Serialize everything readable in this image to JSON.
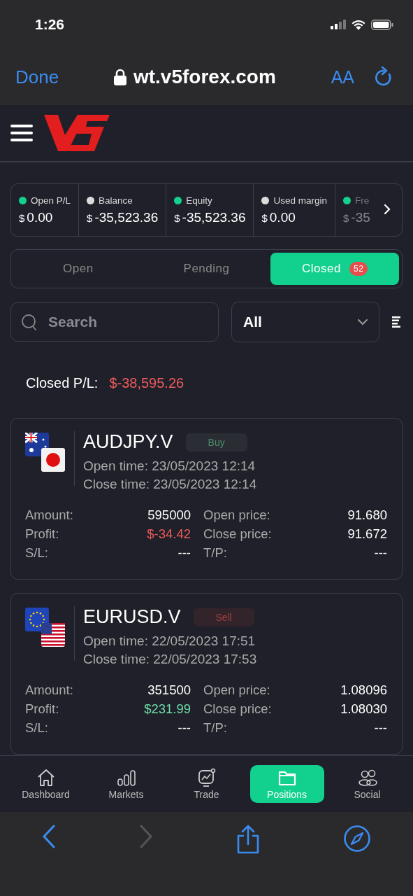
{
  "status_bar": {
    "time": "1:26"
  },
  "browser": {
    "done": "Done",
    "url": "wt.v5forex.com",
    "text_size": "AA",
    "forward_disabled": true
  },
  "summary": [
    {
      "label": "Open P/L",
      "currency": "$",
      "value": "0.00",
      "color": "#12d18e"
    },
    {
      "label": "Balance",
      "currency": "$",
      "value": "-35,523.36",
      "color": "#dcdcdc"
    },
    {
      "label": "Equity",
      "currency": "$",
      "value": "-35,523.36",
      "color": "#12d18e"
    },
    {
      "label": "Used margin",
      "currency": "$",
      "value": "0.00",
      "color": "#dcdcdc"
    },
    {
      "label": "Fre",
      "currency": "$",
      "value": "-35",
      "color": "#12d18e"
    }
  ],
  "tabs": [
    {
      "label": "Open",
      "selected": false
    },
    {
      "label": "Pending",
      "selected": false
    },
    {
      "label": "Closed",
      "selected": true,
      "badge": "52"
    }
  ],
  "search": {
    "placeholder": "Search"
  },
  "filter": {
    "value": "All"
  },
  "closed_pl": {
    "label": "Closed P/L:",
    "value": "$-38,595.26"
  },
  "positions": [
    {
      "symbol": "AUDJPY.V",
      "side": "Buy",
      "kind": "buy",
      "flags": [
        {
          "kind": "australia"
        },
        {
          "kind": "japan"
        }
      ],
      "open_time": "Open time: 23/05/2023 12:14",
      "close_time": "Close time: 23/05/2023 12:14",
      "stats": [
        {
          "label": "Amount:",
          "value": "595000",
          "kind": "plain"
        },
        {
          "label": "Open price:",
          "value": "91.680",
          "kind": "plain"
        },
        {
          "label": "Profit:",
          "value": "$-34.42",
          "kind": "loss"
        },
        {
          "label": "Close price:",
          "value": "91.672",
          "kind": "plain"
        },
        {
          "label": "S/L:",
          "value": "---",
          "kind": "plain"
        },
        {
          "label": "T/P:",
          "value": "---",
          "kind": "plain"
        }
      ]
    },
    {
      "symbol": "EURUSD.V",
      "side": "Sell",
      "kind": "sell",
      "flags": [
        {
          "kind": "eu"
        },
        {
          "kind": "usa"
        }
      ],
      "open_time": "Open time: 22/05/2023 17:51",
      "close_time": "Close time: 22/05/2023 17:53",
      "stats": [
        {
          "label": "Amount:",
          "value": "351500",
          "kind": "plain"
        },
        {
          "label": "Open price:",
          "value": "1.08096",
          "kind": "plain"
        },
        {
          "label": "Profit:",
          "value": "$231.99",
          "kind": "gain"
        },
        {
          "label": "Close price:",
          "value": "1.08030",
          "kind": "plain"
        },
        {
          "label": "S/L:",
          "value": "---",
          "kind": "plain"
        },
        {
          "label": "T/P:",
          "value": "---",
          "kind": "plain"
        }
      ]
    }
  ],
  "nav": [
    {
      "label": "Dashboard",
      "kind": "home",
      "selected": false
    },
    {
      "label": "Markets",
      "kind": "bars",
      "selected": false
    },
    {
      "label": "Trade",
      "kind": "chart",
      "selected": false
    },
    {
      "label": "Positions",
      "kind": "folder",
      "selected": true
    },
    {
      "label": "Social",
      "kind": "people",
      "selected": false
    }
  ]
}
